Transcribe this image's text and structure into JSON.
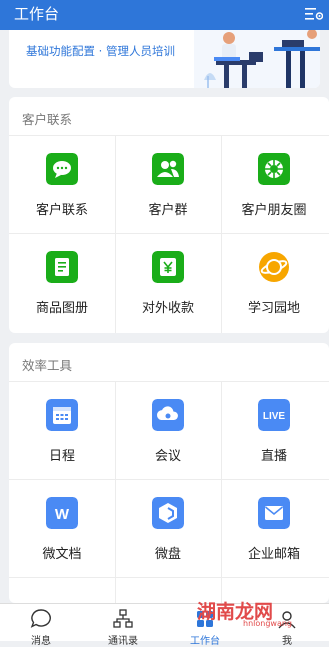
{
  "header": {
    "title": "工作台"
  },
  "banner": {
    "text": "基础功能配置 · 管理人员培训"
  },
  "section1": {
    "title": "客户联系",
    "items": [
      {
        "label": "客户联系",
        "icon": "chat-bubble-icon",
        "color": "#1aad19"
      },
      {
        "label": "客户群",
        "icon": "group-icon",
        "color": "#1aad19"
      },
      {
        "label": "客户朋友圈",
        "icon": "moments-icon",
        "color": "#1aad19"
      },
      {
        "label": "商品图册",
        "icon": "catalog-icon",
        "color": "#1aad19"
      },
      {
        "label": "对外收款",
        "icon": "yuan-icon",
        "color": "#1aad19"
      },
      {
        "label": "学习园地",
        "icon": "planet-icon",
        "color": "#f7a600"
      }
    ]
  },
  "section2": {
    "title": "效率工具",
    "items": [
      {
        "label": "日程",
        "icon": "calendar-icon",
        "color": "#4a8af4"
      },
      {
        "label": "会议",
        "icon": "meeting-icon",
        "color": "#4a8af4"
      },
      {
        "label": "直播",
        "icon": "live-icon",
        "icon_text": "LIVE",
        "color": "#4a8af4"
      },
      {
        "label": "微文档",
        "icon": "doc-icon",
        "icon_text": "W",
        "color": "#4a8af4"
      },
      {
        "label": "微盘",
        "icon": "drive-icon",
        "color": "#4a8af4"
      },
      {
        "label": "企业邮箱",
        "icon": "mail-icon",
        "color": "#4a8af4"
      }
    ]
  },
  "tabbar": {
    "items": [
      {
        "label": "消息",
        "icon": "message-icon"
      },
      {
        "label": "通讯录",
        "icon": "contacts-icon"
      },
      {
        "label": "工作台",
        "icon": "workbench-icon",
        "active": true
      },
      {
        "label": "我",
        "icon": "me-icon"
      }
    ]
  },
  "watermark": {
    "text": "湖南龙网",
    "sub": "hnlongwang"
  },
  "colors": {
    "accent": "#2e76d9",
    "green": "#1aad19",
    "blue": "#4a8af4",
    "orange": "#f7a600"
  }
}
